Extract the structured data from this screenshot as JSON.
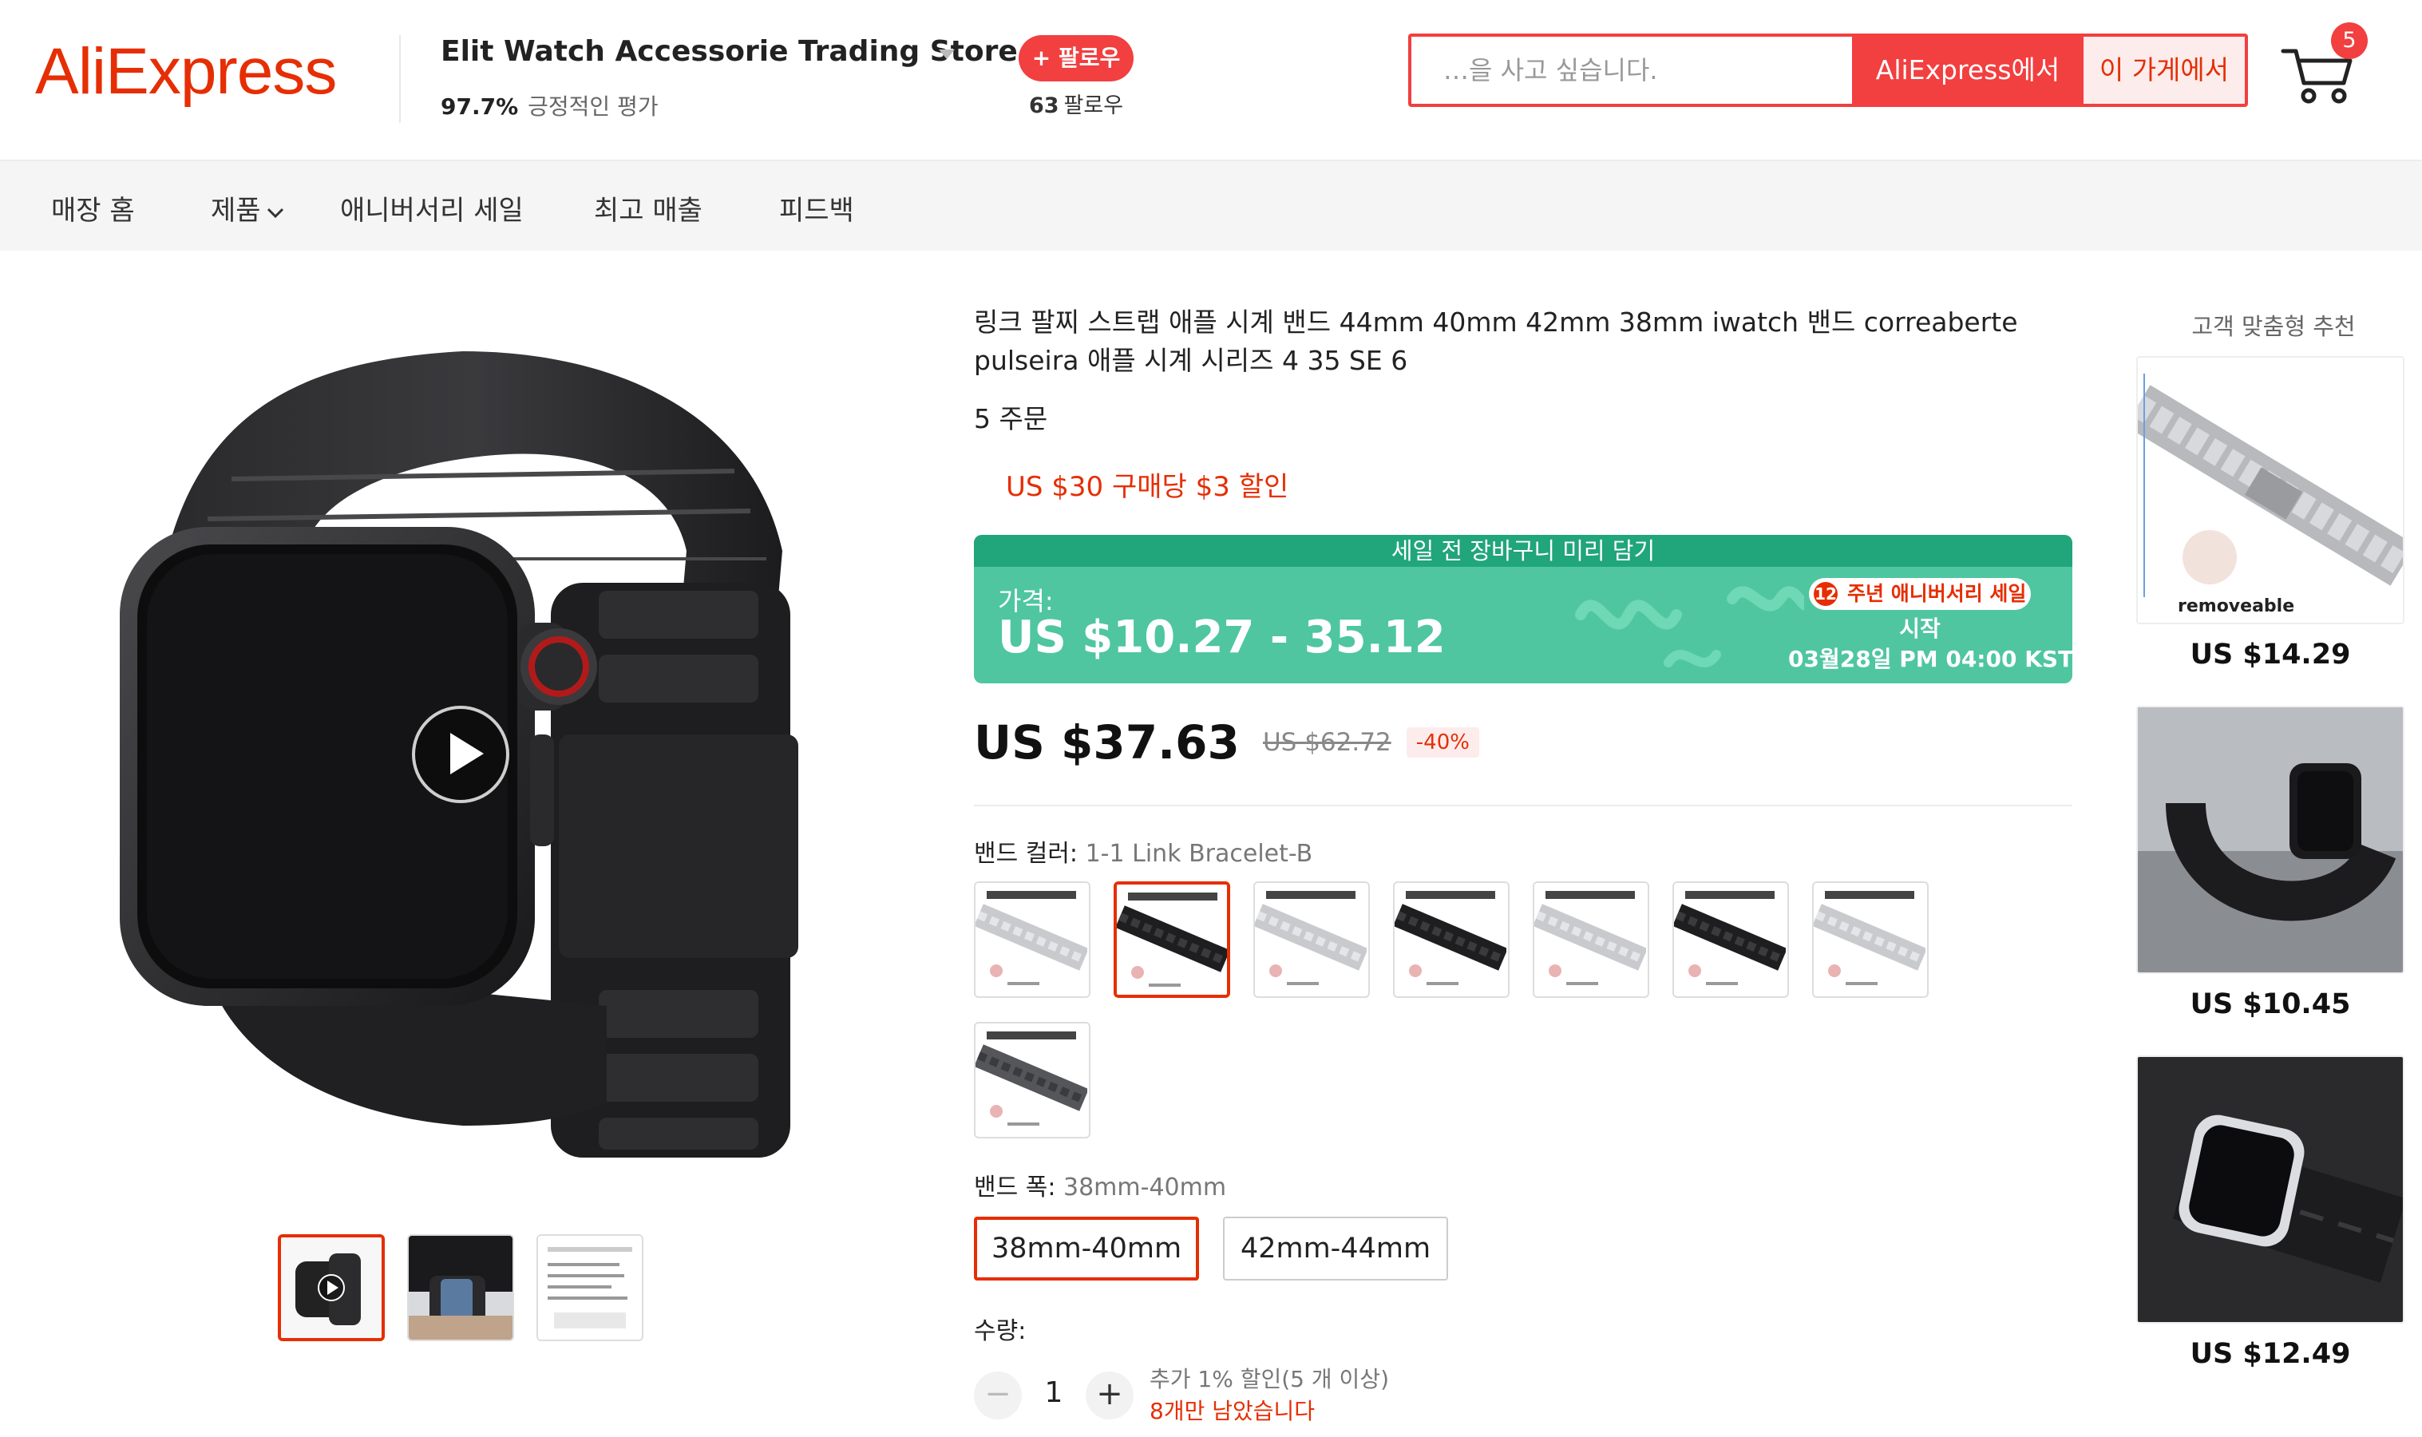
{
  "header": {
    "logo": "AliExpress",
    "store_name": "Elit Watch Accessorie Trading Store",
    "rating_value": "97.7%",
    "rating_label": "긍정적인 평가",
    "follow_label": "+ 팔로우",
    "followers_count": "63",
    "followers_label": "팔로우",
    "search_placeholder": "…을 사고 싶습니다.",
    "search_global_label": "AliExpress에서",
    "search_store_label": "이 가게에서",
    "cart_count": "5"
  },
  "nav": {
    "items": [
      "매장 홈",
      "제품",
      "애니버서리 세일",
      "최고 매출",
      "피드백"
    ]
  },
  "product": {
    "title": "링크 팔찌 스트랩 애플 시계 밴드 44mm 40mm 42mm 38mm iwatch 밴드 correaberte pulseira 애플 시계 시리즈 4 35 SE 6",
    "orders": "5 주문",
    "coupon": "US $30 구매당 $3 할인",
    "sale_banner_top": "세일 전 장바구니 미리 담기",
    "sale_price_label": "가격:",
    "sale_price": "US $10.27 - 35.12",
    "anniversary_badge_num": "12",
    "anniversary_badge": "주년 애니버서리 세일",
    "anniversary_start": "시작",
    "anniversary_date": "03월28일 PM 04:00 KST",
    "price_now": "US $37.63",
    "price_old": "US $62.72",
    "discount": "-40%",
    "color_label": "밴드 컬러:",
    "color_selected": "1-1 Link Bracelet-B",
    "color_swatches": [
      "silver",
      "black",
      "silver",
      "black",
      "silver",
      "black",
      "silver",
      "dark"
    ],
    "selected_swatch_index": 1,
    "width_label": "밴드 폭:",
    "width_selected": "38mm-40mm",
    "widths": [
      "38mm-40mm",
      "42mm-44mm"
    ],
    "qty_label": "수량:",
    "qty_minus": "−",
    "qty_value": "1",
    "qty_plus": "+",
    "qty_note": "추가 1% 할인(5 개 이상)",
    "qty_left": "8개만 남았습니다",
    "swatch_watermark": "removeable"
  },
  "recommend": {
    "title": "고객 맞춤형 추천",
    "items": [
      {
        "price": "US $14.29",
        "caption": "removeable"
      },
      {
        "price": "US $10.45"
      },
      {
        "price": "US $12.49"
      }
    ]
  },
  "colors": {
    "accent": "#e62e04",
    "follow": "#f23f3f",
    "sale_green": "#4fc6a0",
    "sale_green_dark": "#21a57b"
  }
}
